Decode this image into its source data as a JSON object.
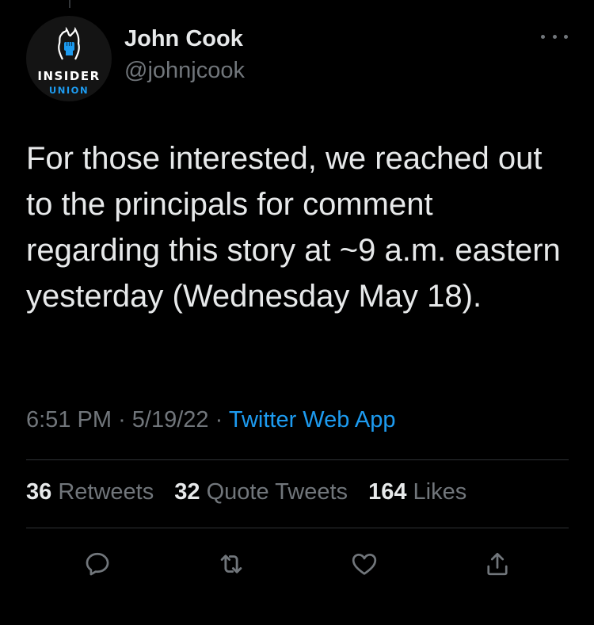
{
  "author": {
    "name": "John Cook",
    "handle": "@johnjcook",
    "avatar_logo": {
      "line1": "INSIDER",
      "line2": "UNION"
    }
  },
  "tweet": {
    "text": "For those interested, we reached out to the principals for comment regarding this story at ~9 a.m. eastern yesterday (Wednesday May 18)."
  },
  "meta": {
    "time": "6:51 PM",
    "separator": "·",
    "date": "5/19/22",
    "source": "Twitter Web App"
  },
  "stats": {
    "retweets_count": "36",
    "retweets_label": "Retweets",
    "quotes_count": "32",
    "quotes_label": "Quote Tweets",
    "likes_count": "164",
    "likes_label": "Likes"
  },
  "actions": [
    "reply-icon",
    "retweet-icon",
    "like-icon",
    "share-icon"
  ],
  "colors": {
    "background": "#000000",
    "text": "#e7e9ea",
    "secondary": "#71767b",
    "accent": "#1d9bf0",
    "divider": "#2f3336"
  }
}
